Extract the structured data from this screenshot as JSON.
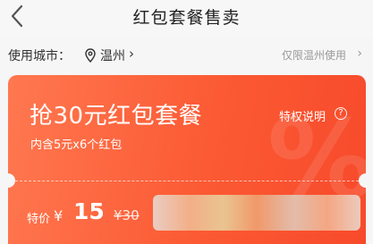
{
  "nav": {
    "title": "红包套餐售卖",
    "back_icon": "chevron-left-icon"
  },
  "city": {
    "label": "使用城市：",
    "name": "温州",
    "chevron": "›",
    "only_text": "仅限温州使用",
    "pin_icon": "location-pin-icon"
  },
  "card": {
    "title": "抢30元红包套餐",
    "subtitle": "内含5元x6个红包",
    "rules_label": "特权说明",
    "rules_icon": "?",
    "watermark": "%",
    "price_label": "特价",
    "currency": "¥",
    "price": "15",
    "original_price": "¥30",
    "accent": "#fb5a34"
  }
}
